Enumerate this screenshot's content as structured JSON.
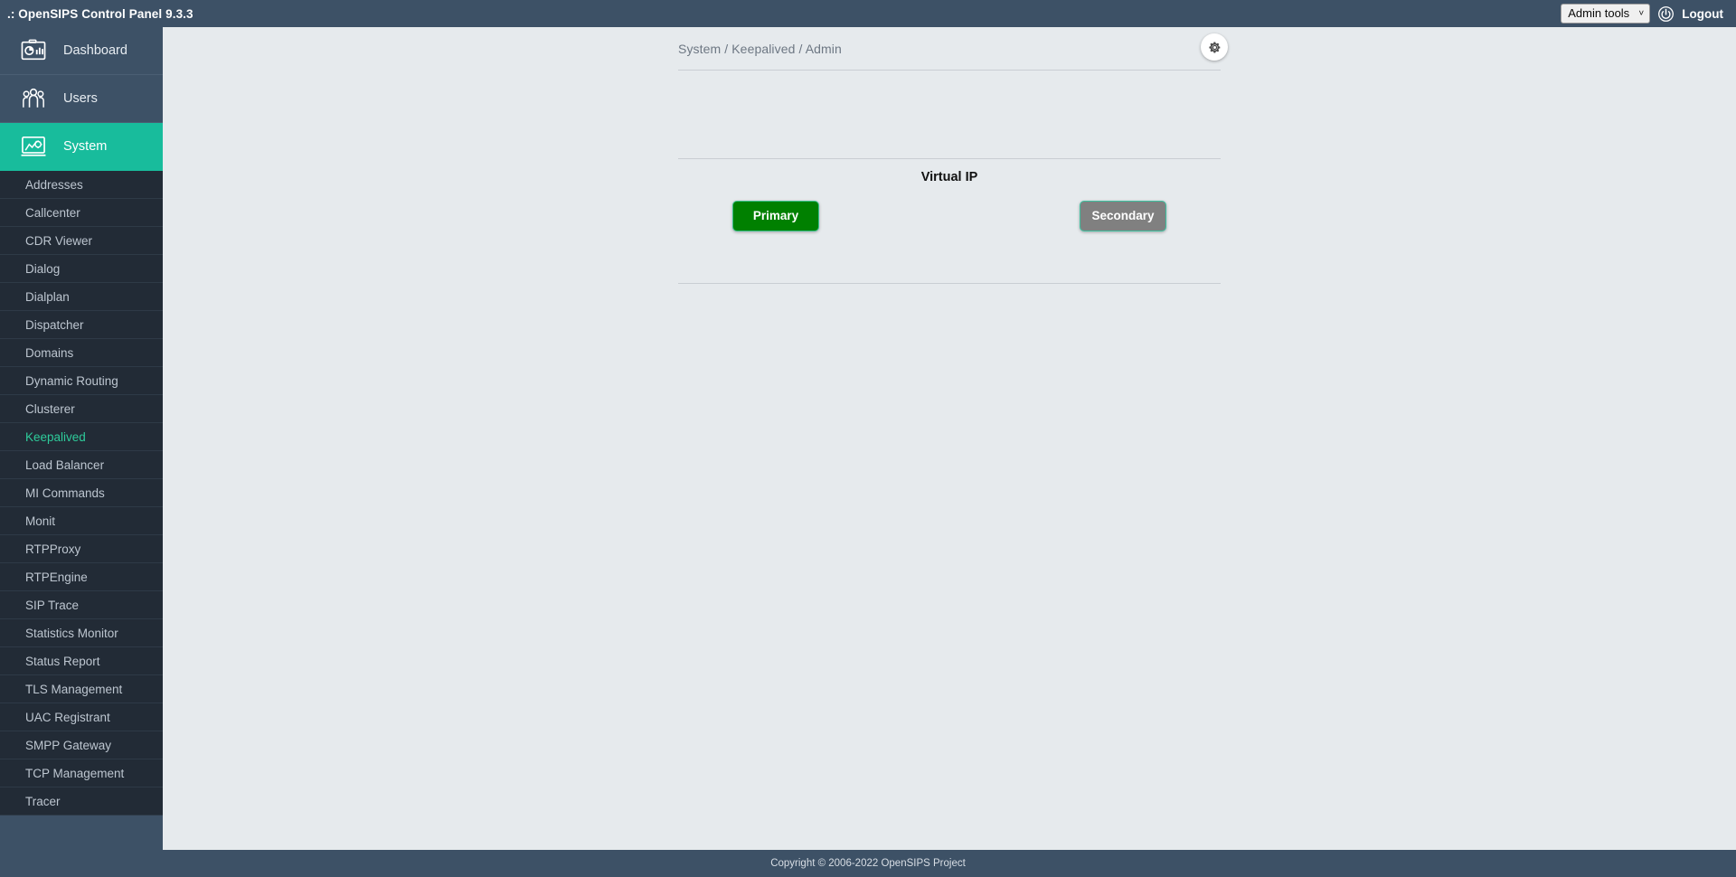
{
  "header": {
    "app_title": ".: OpenSIPS Control Panel 9.3.3",
    "admin_tools_label": "Admin tools",
    "admin_tools_options": [
      "Admin tools"
    ],
    "power_icon": "power-icon",
    "logout_label": "Logout",
    "chevron": "˅"
  },
  "sidebar": {
    "main_items": [
      {
        "label": "Dashboard",
        "icon": "dashboard-icon",
        "active": false
      },
      {
        "label": "Users",
        "icon": "users-icon",
        "active": false
      },
      {
        "label": "System",
        "icon": "system-icon",
        "active": true
      }
    ],
    "sub_items": [
      {
        "label": "Addresses",
        "current": false
      },
      {
        "label": "Callcenter",
        "current": false
      },
      {
        "label": "CDR Viewer",
        "current": false
      },
      {
        "label": "Dialog",
        "current": false
      },
      {
        "label": "Dialplan",
        "current": false
      },
      {
        "label": "Dispatcher",
        "current": false
      },
      {
        "label": "Domains",
        "current": false
      },
      {
        "label": "Dynamic Routing",
        "current": false
      },
      {
        "label": "Clusterer",
        "current": false
      },
      {
        "label": "Keepalived",
        "current": true
      },
      {
        "label": "Load Balancer",
        "current": false
      },
      {
        "label": "MI Commands",
        "current": false
      },
      {
        "label": "Monit",
        "current": false
      },
      {
        "label": "RTPProxy",
        "current": false
      },
      {
        "label": "RTPEngine",
        "current": false
      },
      {
        "label": "SIP Trace",
        "current": false
      },
      {
        "label": "Statistics Monitor",
        "current": false
      },
      {
        "label": "Status Report",
        "current": false
      },
      {
        "label": "TLS Management",
        "current": false
      },
      {
        "label": "UAC Registrant",
        "current": false
      },
      {
        "label": "SMPP Gateway",
        "current": false
      },
      {
        "label": "TCP Management",
        "current": false
      },
      {
        "label": "Tracer",
        "current": false
      }
    ]
  },
  "main": {
    "breadcrumb": "System / Keepalived / Admin",
    "settings_icon": "gear-icon",
    "section_title": "Virtual IP",
    "buttons": [
      {
        "label": "Primary",
        "state": "active",
        "bg": "#008000",
        "border": "#3cc08c"
      },
      {
        "label": "Secondary",
        "state": "inactive",
        "bg": "#808080",
        "border": "#3ec2a0"
      }
    ]
  },
  "footer": {
    "copyright": "Copyright © 2006-2022 OpenSIPS Project"
  },
  "colors": {
    "header_bg": "#3d5166",
    "sidebar_bg": "#222b36",
    "accent_teal": "#18bc9c",
    "content_bg": "#e6eaed"
  }
}
